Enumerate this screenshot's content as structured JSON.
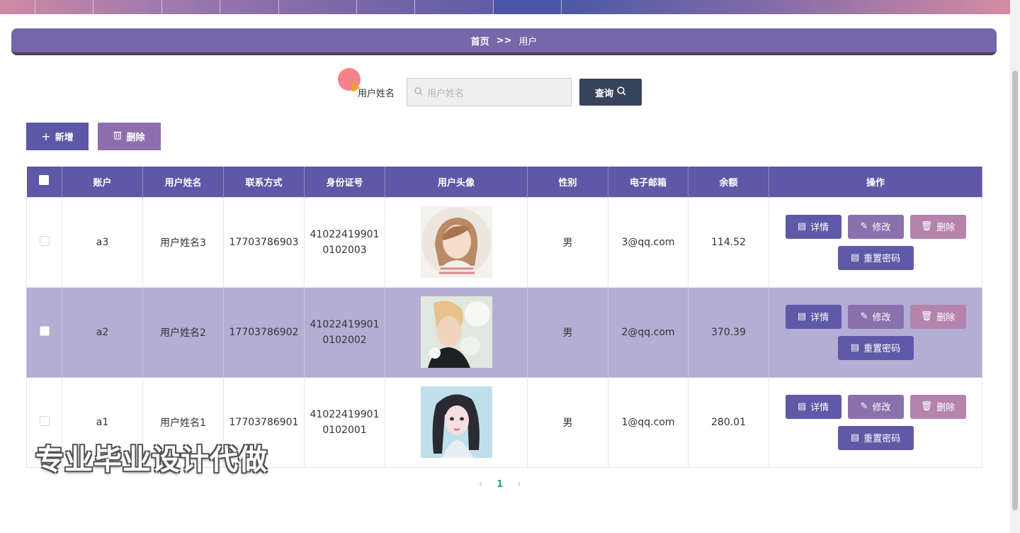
{
  "breadcrumb": {
    "home": "首页",
    "sep": ">>",
    "current": "用户"
  },
  "search": {
    "label": "用户姓名",
    "placeholder": "用户姓名",
    "button": "查询"
  },
  "actions": {
    "add": "新增",
    "delete": "删除"
  },
  "table": {
    "headers": [
      "账户",
      "用户姓名",
      "联系方式",
      "身份证号",
      "用户头像",
      "性别",
      "电子邮箱",
      "余额",
      "操作"
    ],
    "rows": [
      {
        "account": "a3",
        "name": "用户姓名3",
        "phone": "17703786903",
        "id_line1": "41022419901",
        "id_line2": "0102003",
        "gender": "男",
        "email": "3@qq.com",
        "balance": "114.52"
      },
      {
        "account": "a2",
        "name": "用户姓名2",
        "phone": "17703786902",
        "id_line1": "41022419901",
        "id_line2": "0102002",
        "gender": "男",
        "email": "2@qq.com",
        "balance": "370.39"
      },
      {
        "account": "a1",
        "name": "用户姓名1",
        "phone": "17703786901",
        "id_line1": "41022419901",
        "id_line2": "0102001",
        "gender": "男",
        "email": "1@qq.com",
        "balance": "280.01"
      }
    ],
    "ops": {
      "detail": "详情",
      "edit": "修改",
      "remove": "删除",
      "reset": "重置密码"
    }
  },
  "pager": {
    "prev": "‹",
    "current": "1",
    "next": "›"
  },
  "watermark": "专业毕业设计代做",
  "colors": {
    "primary": "#5e58a6",
    "accent": "#8a71ae",
    "delete": "#b584ad",
    "query": "#36435a"
  }
}
